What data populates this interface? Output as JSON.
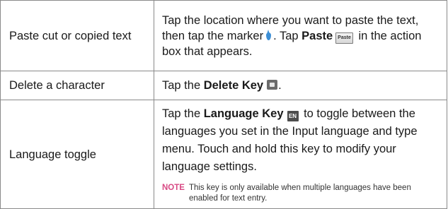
{
  "rows": [
    {
      "label": "Paste cut or copied text",
      "desc_part1": "Tap the location where you want to paste the text, then tap the marker",
      "desc_part2": ". Tap ",
      "paste_bold": "Paste",
      "paste_icon_text": "Paste",
      "desc_part3": " in the action box that appears."
    },
    {
      "label": "Delete a character",
      "desc_part1": "Tap the ",
      "delete_bold": "Delete Key",
      "desc_part2": "."
    },
    {
      "label": "Language toggle",
      "desc_part1": "Tap the ",
      "language_bold": "Language Key",
      "lang_icon_text": "EN",
      "desc_part2": " to toggle between the languages you set in the Input language and type menu. Touch and hold this key to modify your language settings.",
      "note_label": "NOTE",
      "note_text": "This key is only available when multiple languages have been enabled for text entry."
    }
  ],
  "icons": {
    "marker": "marker-drop-icon",
    "paste": "paste-button-icon",
    "delete": "delete-key-icon",
    "language": "language-key-icon"
  },
  "colors": {
    "border": "#8a8a8a",
    "note_label": "#d84a84",
    "marker": "#3d8fd6"
  }
}
